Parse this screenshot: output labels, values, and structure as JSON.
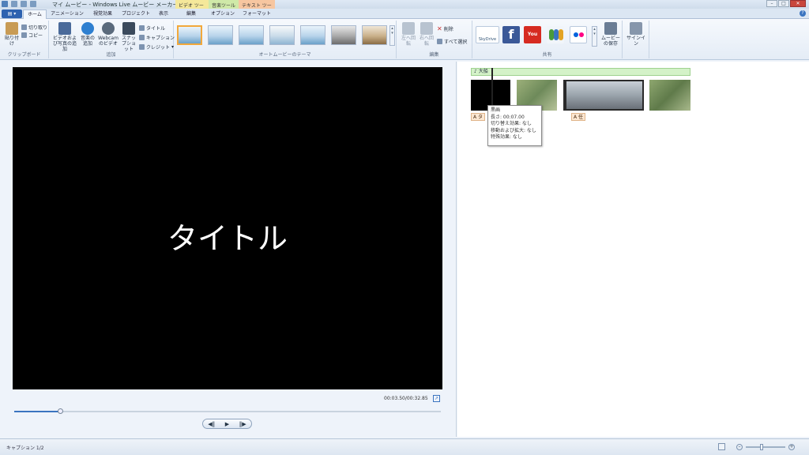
{
  "window": {
    "title": "マイ ムービー - Windows Live ムービー メーカー",
    "context_tabs": [
      "ビデオ ツール",
      "音楽ツール",
      "テキスト ツール"
    ]
  },
  "tabs": [
    "ホーム",
    "アニメーション",
    "視覚効果",
    "プロジェクト",
    "表示",
    "編集",
    "オプション",
    "フォーマット"
  ],
  "ribbon": {
    "clipboard": {
      "paste": "貼り付け",
      "cut": "切り取り",
      "copy": "コピー",
      "group": "クリップボード"
    },
    "add": {
      "video_photo": "ビデオおよび写真の追加",
      "music": "音楽の追加",
      "webcam": "Webcamのビデオ",
      "snapshot": "スナップショット",
      "title": "タイトル",
      "caption": "キャプション",
      "credit": "クレジット",
      "group": "追加"
    },
    "themes_group": "オートムービーのテーマ",
    "edit": {
      "rotate_left": "左へ回転",
      "rotate_right": "右へ回転",
      "delete": "削除",
      "select_all": "すべて選択",
      "group": "編集"
    },
    "share": {
      "skydrive": "SkyDrive",
      "save_movie": "ムービーの保存",
      "group": "共有"
    },
    "signin": "サインイン"
  },
  "preview": {
    "overlay_text": "タイトル",
    "time": "00:03.50/00:32.85",
    "seek_fraction": 0.11
  },
  "storyboard": {
    "music_label": "♪ 大船",
    "caption_labels": [
      "A タ",
      "A 任"
    ],
    "tooltip": {
      "title": "黒画",
      "length": "長さ: 00:07.00",
      "transition": "切り替え効果: なし",
      "pan_zoom": "移動および拡大: なし",
      "effects": "特殊効果: なし"
    }
  },
  "status": {
    "text": "キャプション 1/2"
  }
}
